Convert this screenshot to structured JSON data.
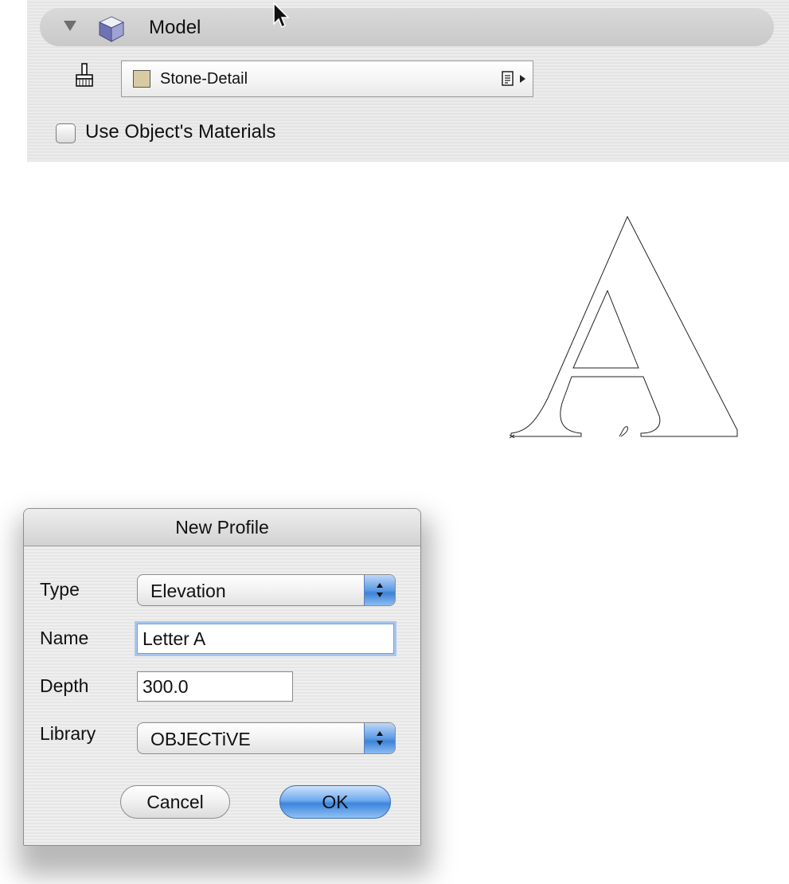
{
  "model_panel": {
    "title": "Model",
    "material": {
      "name": "Stone-Detail",
      "swatch_color": "#d9cba1"
    },
    "use_object_materials": {
      "label": "Use Object's Materials",
      "checked": false
    }
  },
  "dialog": {
    "title": "New Profile",
    "type": {
      "label": "Type",
      "value": "Elevation"
    },
    "name": {
      "label": "Name",
      "value": "Letter A"
    },
    "depth": {
      "label": "Depth",
      "value": "300.0"
    },
    "library": {
      "label": "Library",
      "value": "OBJECTiVE"
    },
    "cancel_label": "Cancel",
    "ok_label": "OK"
  },
  "icons": [
    "disclosure-triangle-icon",
    "cube-icon",
    "cursor-icon",
    "paint-brush-icon",
    "document-icon",
    "menu-arrow-icon",
    "stepper-arrows-icon"
  ],
  "colors": {
    "accent": "#3d85dc",
    "focus_ring": "#a7c6ee"
  }
}
